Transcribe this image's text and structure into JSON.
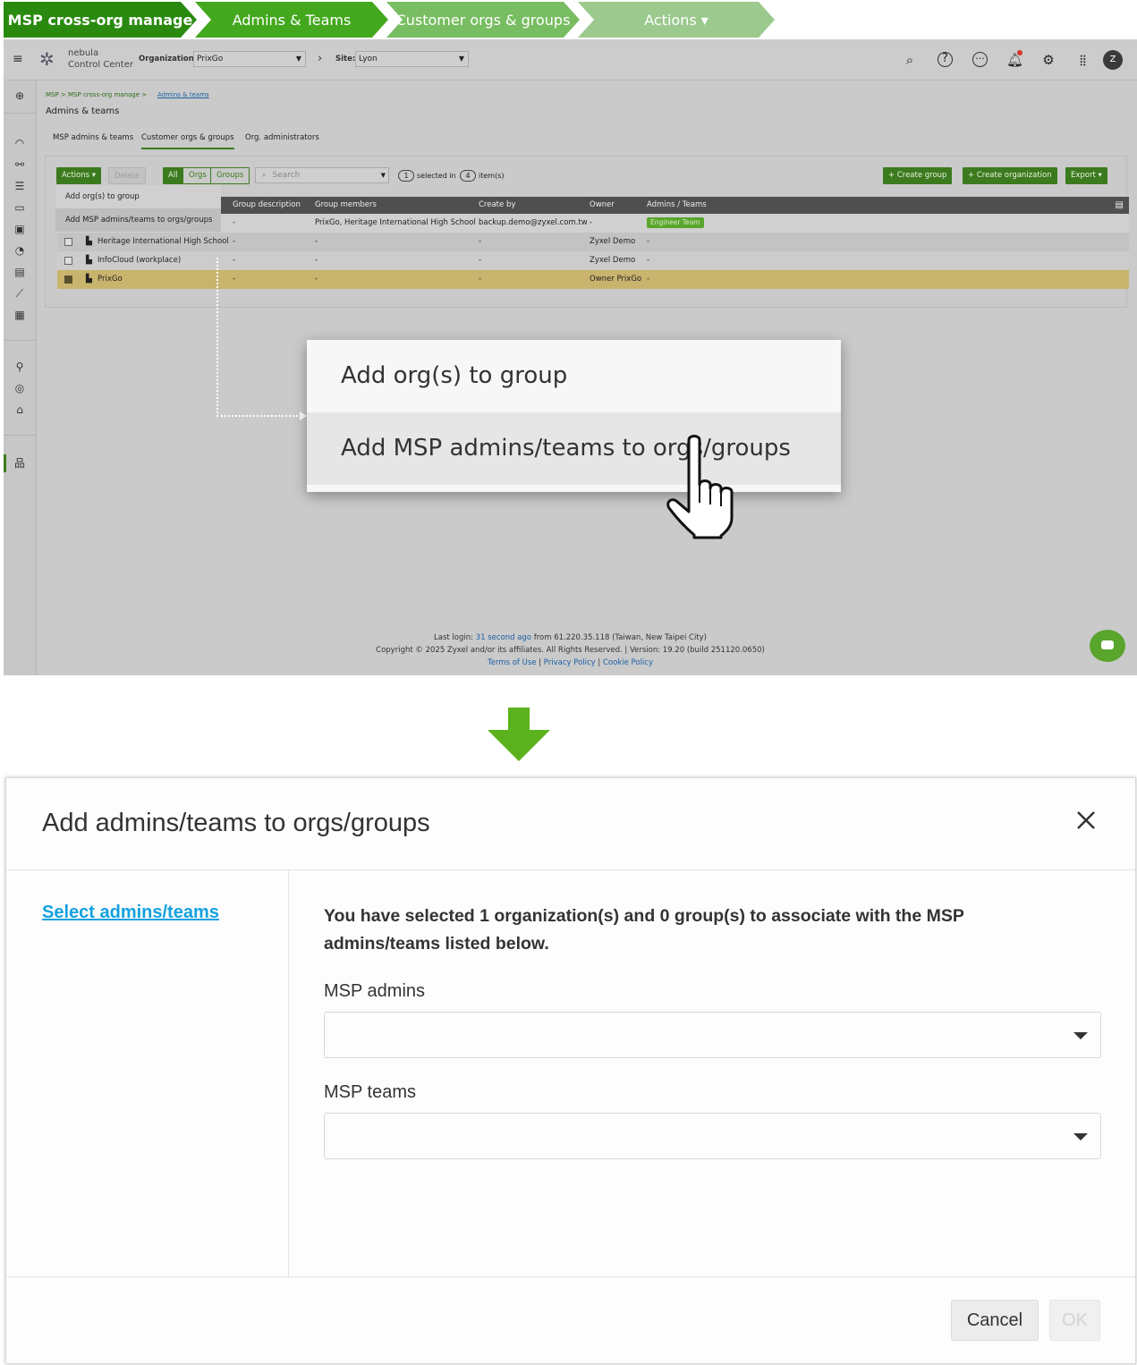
{
  "breadcrumb": {
    "steps": [
      {
        "label": "MSP cross-org manage",
        "color": "#2a8a10"
      },
      {
        "label": "Admins & Teams",
        "color": "#44a81e"
      },
      {
        "label": "Customer orgs & groups",
        "color": "#79bd62"
      },
      {
        "label": "Actions ▾",
        "color": "#9bc98e"
      }
    ]
  },
  "app": {
    "logo_line1": "nebula",
    "logo_line2": "Control Center",
    "org_label": "Organization:",
    "org_value": "PrixGo",
    "site_label": "Site:",
    "site_value": "Lyon",
    "avatar_letter": "Z",
    "page_breadcrumb": "MSP > MSP cross-org manage >",
    "page_breadcrumb_link": "Admins & teams",
    "page_title": "Admins & teams",
    "tabs": [
      "MSP admins & teams",
      "Customer orgs & groups",
      "Org. administrators"
    ],
    "toolbar": {
      "actions": "Actions ▾",
      "delete": "Delete",
      "filter_all": "All",
      "filter_orgs": "Orgs",
      "filter_groups": "Groups",
      "search_placeholder": "Search",
      "selected_count": "1",
      "selected_in": "selected in",
      "item_count": "4",
      "items": "item(s)",
      "create_group": "+ Create group",
      "create_org": "+ Create organization",
      "export": "Export ▾"
    },
    "actions_menu": [
      "Add org(s) to group",
      "Add MSP admins/teams to orgs/groups"
    ],
    "table_headers": [
      "Group description",
      "Group members",
      "Create by",
      "Owner",
      "Admins / Teams"
    ],
    "rows": [
      {
        "name": "",
        "desc": "-",
        "members": "PrixGo, Heritage International High School",
        "created_by": "backup.demo@zyxel.com.tw",
        "owner": "-",
        "admins": "Engineer Team"
      },
      {
        "name": "Heritage International High School",
        "desc": "-",
        "members": "-",
        "created_by": "-",
        "owner": "Zyxel Demo",
        "admins": "-"
      },
      {
        "name": "InfoCloud (workplace)",
        "desc": "-",
        "members": "-",
        "created_by": "-",
        "owner": "Zyxel Demo",
        "admins": "-"
      },
      {
        "name": "PrixGo",
        "desc": "-",
        "members": "-",
        "created_by": "-",
        "owner": "Owner PrixGo",
        "admins": "-"
      }
    ],
    "popup_items": [
      "Add org(s) to group",
      "Add MSP admins/teams to orgs/groups"
    ],
    "footer": {
      "last_login": "Last login:",
      "last_login_link": "31 second ago",
      "last_login_from": "from 61.220.35.118 (Taiwan, New Taipei City)",
      "copyright": "Copyright © 2025 Zyxel and/or its affiliates. All Rights Reserved. | Version: 19.20 (build 251120.0650)",
      "terms": "Terms of Use",
      "privacy": "Privacy Policy",
      "cookie": "Cookie Policy"
    }
  },
  "modal": {
    "title": "Add admins/teams to orgs/groups",
    "step_link": "Select admins/teams",
    "intro": "You have selected 1 organization(s) and 0 group(s) to associate with the MSP admins/teams listed below.",
    "msp_admins_label": "MSP admins",
    "msp_teams_label": "MSP teams",
    "cancel": "Cancel",
    "ok": "OK"
  }
}
